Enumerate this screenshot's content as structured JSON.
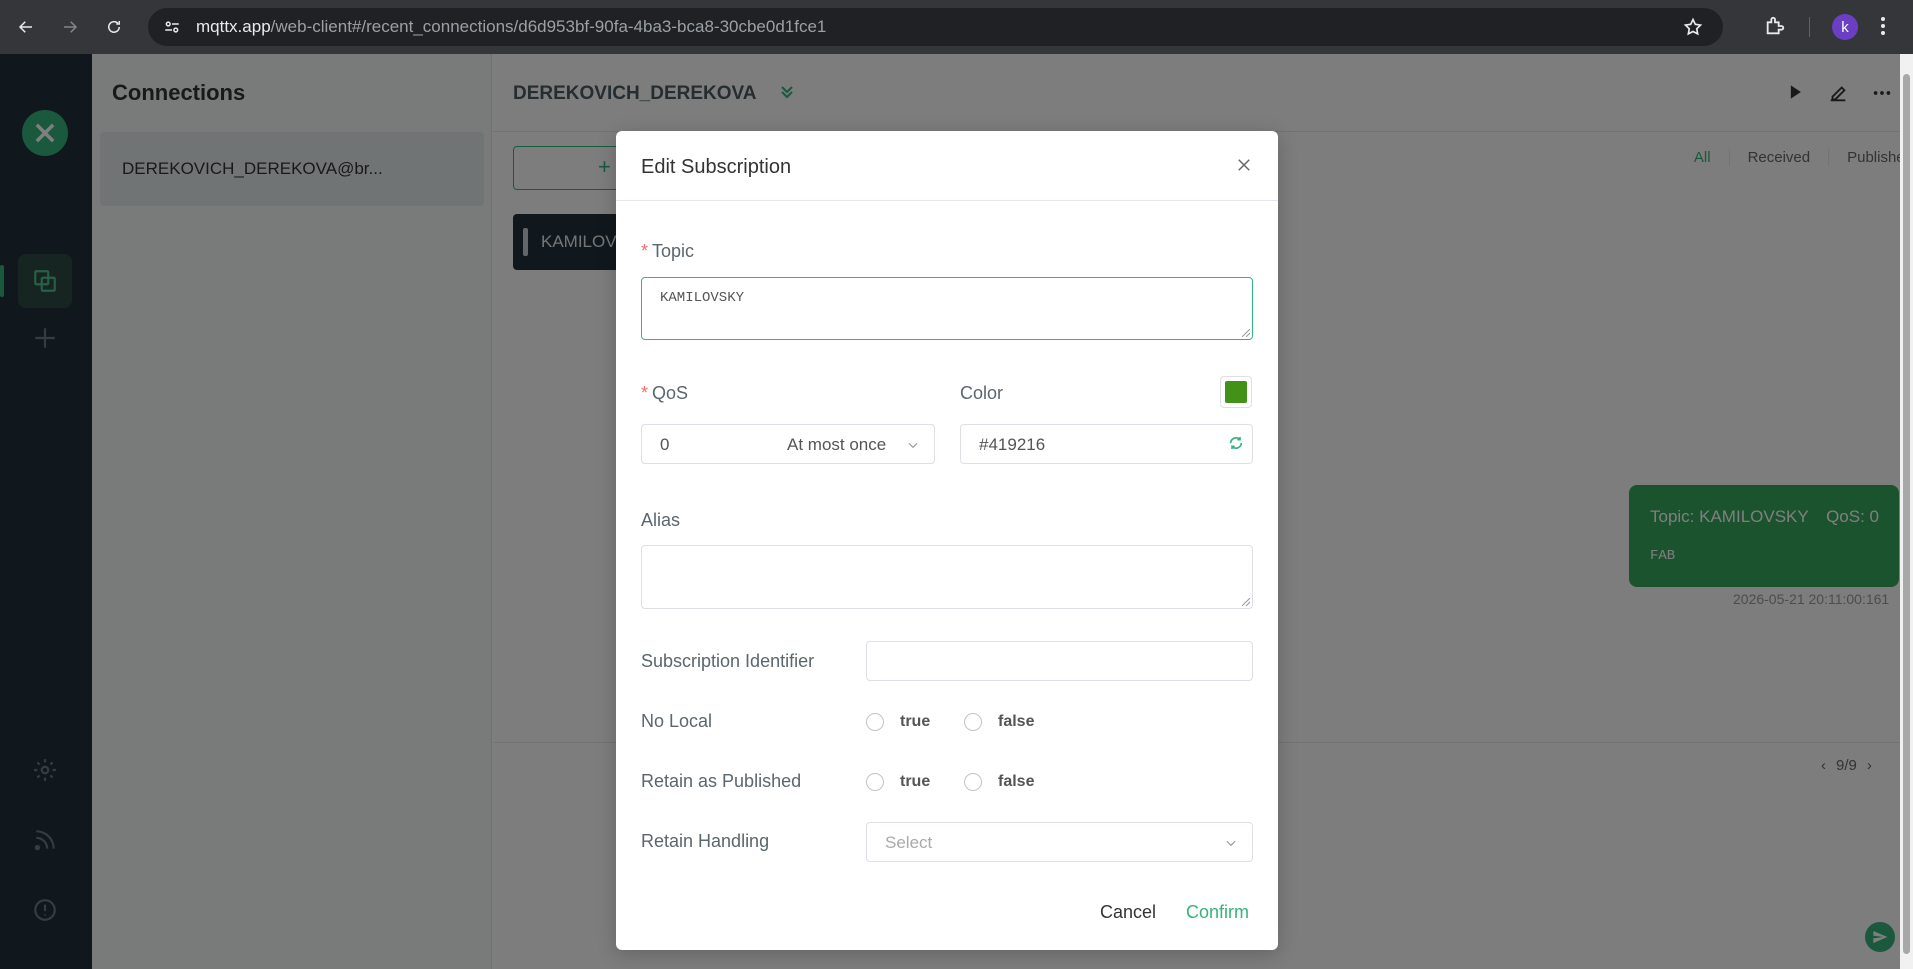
{
  "browser": {
    "url_host": "mqttx.app",
    "url_path": "/web-client#/recent_connections/d6d953bf-90fa-4ba3-bca8-30cbe0d1fce1",
    "profile_initial": "k"
  },
  "sidebar": {
    "title": "Connections",
    "connection_name": "DEREKOVICH_DEREKOVA@br..."
  },
  "main": {
    "connection_title": "DEREKOVICH_DEREKOVA",
    "add_subscription_label": "+",
    "subscription_item": "KAMILOVS",
    "filter_tabs": [
      "All",
      "Received",
      "Published"
    ],
    "message": {
      "topic": "Topic: KAMILOVSKY",
      "qos": "QoS: 0",
      "payload": "FAB",
      "time": "2026-05-21 20:11:00:161"
    },
    "pager": "9/9"
  },
  "modal": {
    "title": "Edit Subscription",
    "topic_label": "Topic",
    "topic_value": "KAMILOVSKY",
    "qos_label": "QoS",
    "qos_value": "0",
    "qos_text": "At most once",
    "color_label": "Color",
    "color_value": "#419216",
    "alias_label": "Alias",
    "sub_id_label": "Subscription Identifier",
    "no_local_label": "No Local",
    "retain_published_label": "Retain as Published",
    "retain_handling_label": "Retain Handling",
    "retain_handling_placeholder": "Select",
    "true_label": "true",
    "false_label": "false",
    "cancel_label": "Cancel",
    "confirm_label": "Confirm"
  },
  "colors": {
    "accent": "#36b37e",
    "subscription_color": "#419216",
    "rail_bg": "#23313a"
  }
}
